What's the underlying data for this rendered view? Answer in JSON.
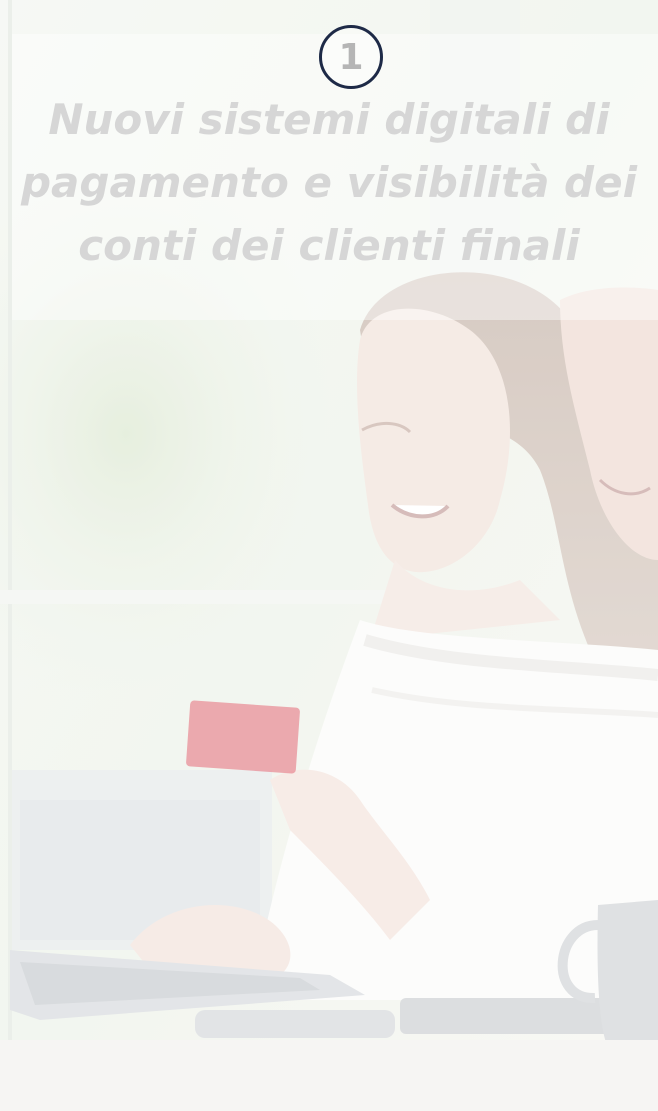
{
  "step": {
    "number": "1"
  },
  "title": "Nuovi sistemi digitali di pagamento e visibilità dei conti dei clienti finali",
  "colors": {
    "badge_border": "#1e2a47",
    "badge_number": "#b5b5b5",
    "title_text": "#d6d6d6",
    "payment_card": "#e05a68"
  }
}
